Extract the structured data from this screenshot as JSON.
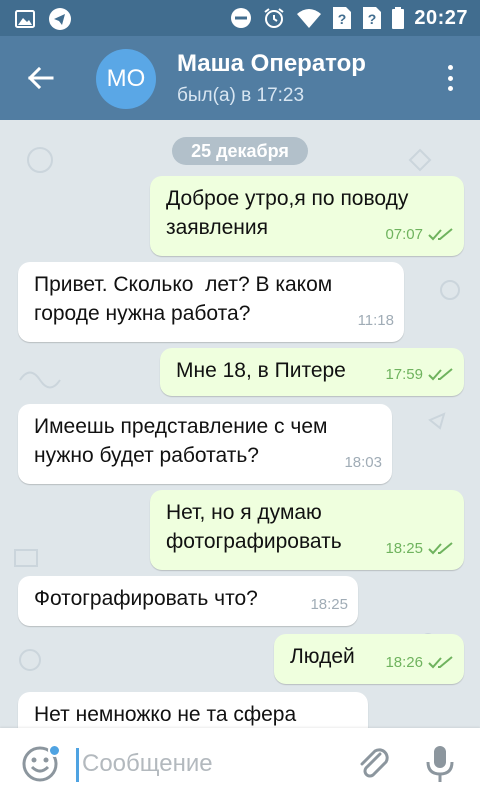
{
  "status_bar": {
    "time": "20:27",
    "left_icons": [
      "image-icon",
      "telegram-icon"
    ],
    "right_icons": [
      "do-not-disturb-icon",
      "alarm-icon",
      "wifi-icon",
      "sim-unknown-icon",
      "sim-unknown-icon",
      "battery-icon"
    ]
  },
  "header": {
    "avatar_initials": "МО",
    "name": "Маша Оператор",
    "status": "был(а) в 17:23",
    "back_icon": "arrow-back-icon",
    "menu_icon": "more-vertical-icon"
  },
  "chat": {
    "date": "25 декабря",
    "messages": [
      {
        "direction": "out",
        "text": "Доброе утро,я по поводу\nзаявления",
        "time": "07:07",
        "read": true
      },
      {
        "direction": "in",
        "text": "Привет. Сколько  лет? В каком\nгороде нужна работа?",
        "time": "11:18"
      },
      {
        "direction": "out",
        "text": "Мне 18, в Питере",
        "time": "17:59",
        "read": true
      },
      {
        "direction": "in",
        "text": "Имеешь представление с чем\nнужно будет работать?",
        "time": "18:03"
      },
      {
        "direction": "out",
        "text": "Нет, но я думаю\nфотографировать",
        "time": "18:25",
        "read": true
      },
      {
        "direction": "in",
        "text": "Фотографировать что?",
        "time": "18:25"
      },
      {
        "direction": "out",
        "text": "Людей",
        "time": "18:26",
        "read": true
      },
      {
        "direction": "in",
        "text": "Нет немножко не та сфера",
        "time": ""
      }
    ]
  },
  "composer": {
    "placeholder": "Сообщение",
    "value": "",
    "emoji_icon": "emoji-icon",
    "attach_icon": "paperclip-icon",
    "mic_icon": "microphone-icon"
  },
  "colors": {
    "status_bar": "#416d8f",
    "header": "#517da2",
    "avatar": "#5aa7e6",
    "outgoing_bubble": "#efffde",
    "incoming_bubble": "#ffffff",
    "check_marks": "#6fb35e",
    "chat_background": "#dfe6ea",
    "accent": "#4fa3e2"
  }
}
